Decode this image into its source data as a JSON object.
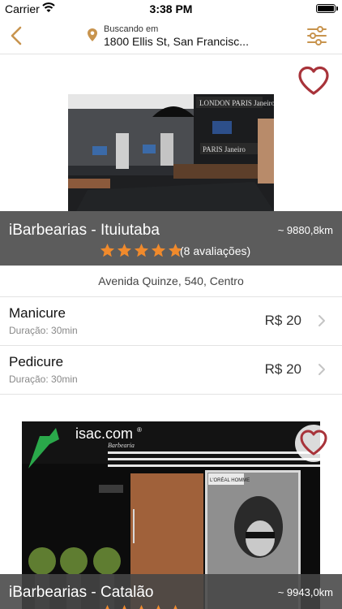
{
  "status_bar": {
    "carrier": "Carrier",
    "time": "3:38 PM"
  },
  "nav": {
    "location_label": "Buscando em",
    "location_address": "1800 Ellis St, San Francisc...",
    "icons": {
      "back": "chevron-left-icon",
      "pin": "map-pin-icon",
      "filter": "sliders-icon"
    }
  },
  "colors": {
    "accent": "#c8944e",
    "star": "#f08a2c",
    "heart": "#a8333a",
    "info_bar": "#464646"
  },
  "shops": [
    {
      "name": "iBarbearias - Ituiutaba",
      "distance": "~ 9880,8km",
      "rating_stars": 5,
      "reviews": "(8 avaliações)",
      "address": "Avenida Quinze, 540, Centro",
      "services": [
        {
          "name": "Manicure",
          "duration": "Duração: 30min",
          "price": "R$ 20"
        },
        {
          "name": "Pedicure",
          "duration": "Duração: 30min",
          "price": "R$ 20"
        }
      ]
    },
    {
      "name": "iBarbearias - Catalão",
      "distance": "~ 9943,0km",
      "rating_stars": 5,
      "signage": {
        "brand": "isac.com",
        "registered": "®",
        "tagline": "Barbearia",
        "poster_brand": "L'ORÉAL HOMME"
      }
    }
  ]
}
